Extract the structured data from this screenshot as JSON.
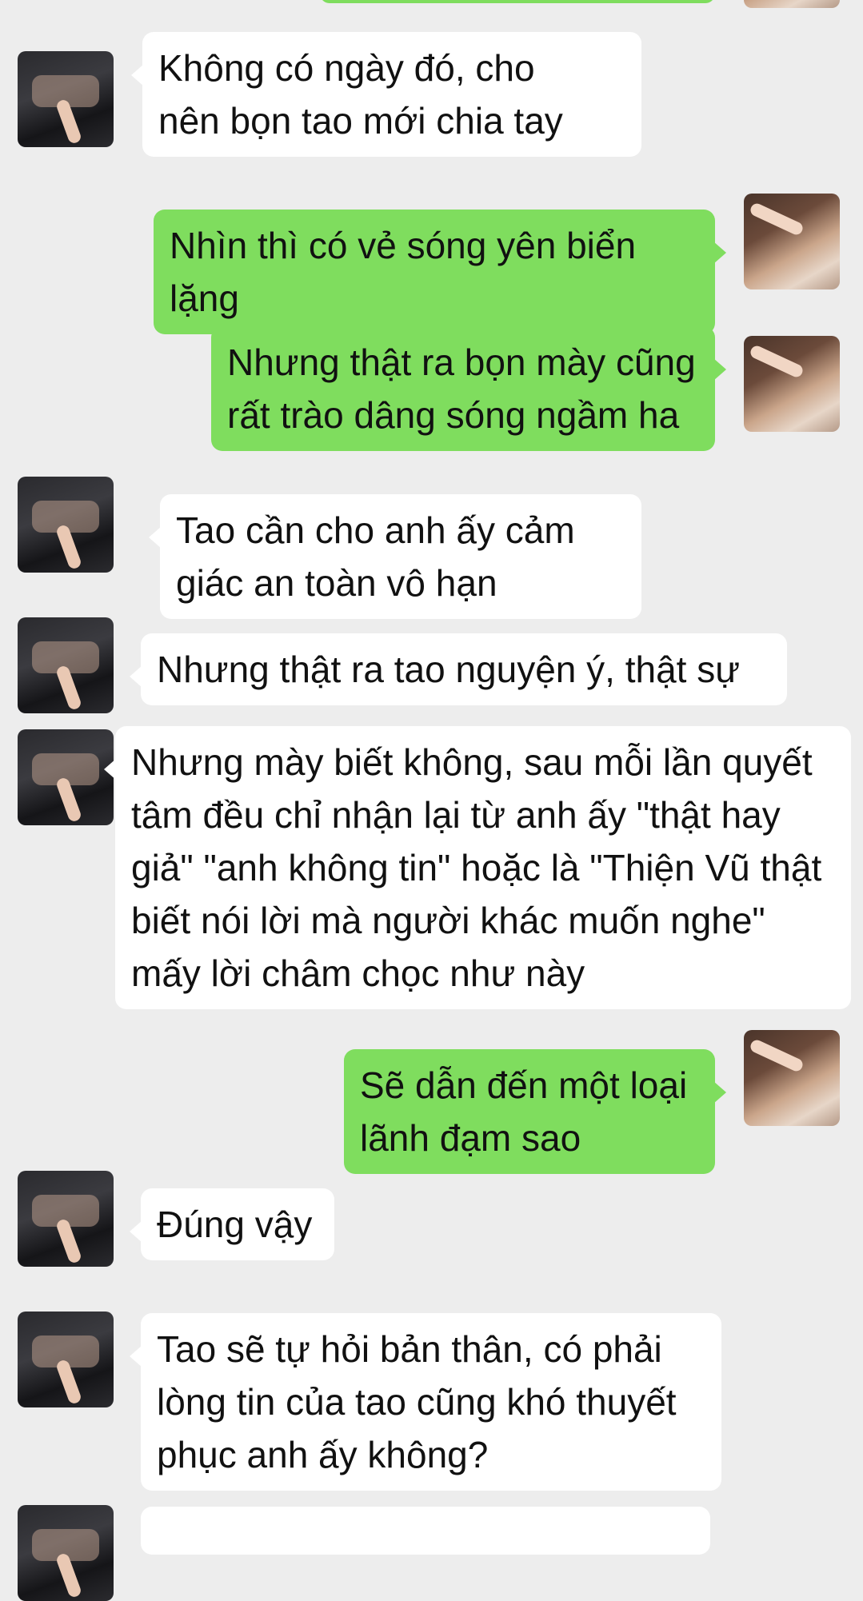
{
  "colors": {
    "background": "#ededed",
    "sent_bubble": "#7fdd5e",
    "received_bubble": "#ffffff"
  },
  "messages": [
    {
      "sender": "friend",
      "text": "Không có ngày đó, cho\nnên bọn tao mới chia tay"
    },
    {
      "sender": "me",
      "text": "Nhìn thì có vẻ sóng yên biển lặng"
    },
    {
      "sender": "me",
      "text": "Nhưng thật ra bọn mày cũng\nrất trào dâng sóng ngầm ha"
    },
    {
      "sender": "friend",
      "text": "Tao cần cho anh ấy cảm\ngiác an toàn vô hạn"
    },
    {
      "sender": "friend",
      "text": "Nhưng thật ra tao nguyện ý, thật sự"
    },
    {
      "sender": "friend",
      "text": "Nhưng mày biết không, sau mỗi lần quyết\ntâm đều chỉ nhận lại từ anh ấy \"thật hay\ngiả\" \"anh không tin\" hoặc là \"Thiện Vũ thật\nbiết nói lời mà người khác muốn nghe\"\nmấy lời châm chọc như này"
    },
    {
      "sender": "me",
      "text": "Sẽ dẫn đến một loại\nlãnh đạm sao"
    },
    {
      "sender": "friend",
      "text": "Đúng vậy"
    },
    {
      "sender": "friend",
      "text": "Tao sẽ tự hỏi bản thân, có phải\nlòng tin của tao cũng khó thuyết\nphục anh ấy không?"
    }
  ]
}
